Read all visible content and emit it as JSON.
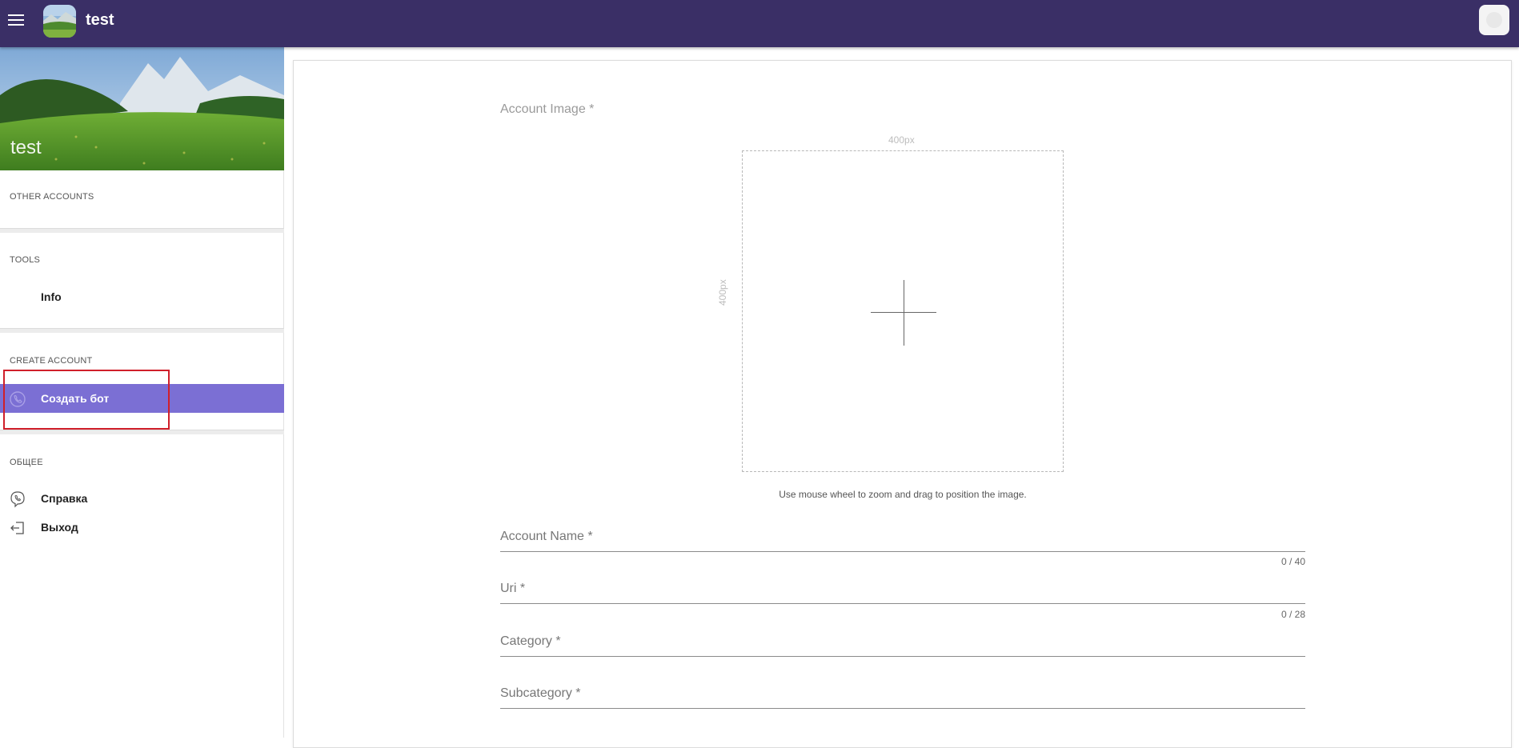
{
  "header": {
    "title": "test",
    "menu_icon": "hamburger-icon",
    "avatar_icon": "landscape-avatar",
    "right_icon": "profile-icon"
  },
  "sidebar": {
    "banner_name": "test",
    "sections": {
      "other_accounts": "OTHER ACCOUNTS",
      "tools": "TOOLS",
      "create_account": "CREATE ACCOUNT",
      "general": "ОБЩЕЕ"
    },
    "items": {
      "info": "Info",
      "create_bot": "Создать бот",
      "help": "Справка",
      "logout": "Выход"
    },
    "active_color": "#7b6fd4"
  },
  "form": {
    "account_image_label": "Account Image *",
    "image_width_hint": "400px",
    "image_height_hint": "400px",
    "image_hint": "Use mouse wheel to zoom and drag to position the image.",
    "account_name_placeholder": "Account Name *",
    "account_name_counter": "0 / 40",
    "uri_placeholder": "Uri *",
    "uri_counter": "0 / 28",
    "category_placeholder": "Category *",
    "subcategory_placeholder": "Subcategory *"
  },
  "colors": {
    "topbar": "#3a2f66",
    "highlight_border": "#d01f2a"
  }
}
